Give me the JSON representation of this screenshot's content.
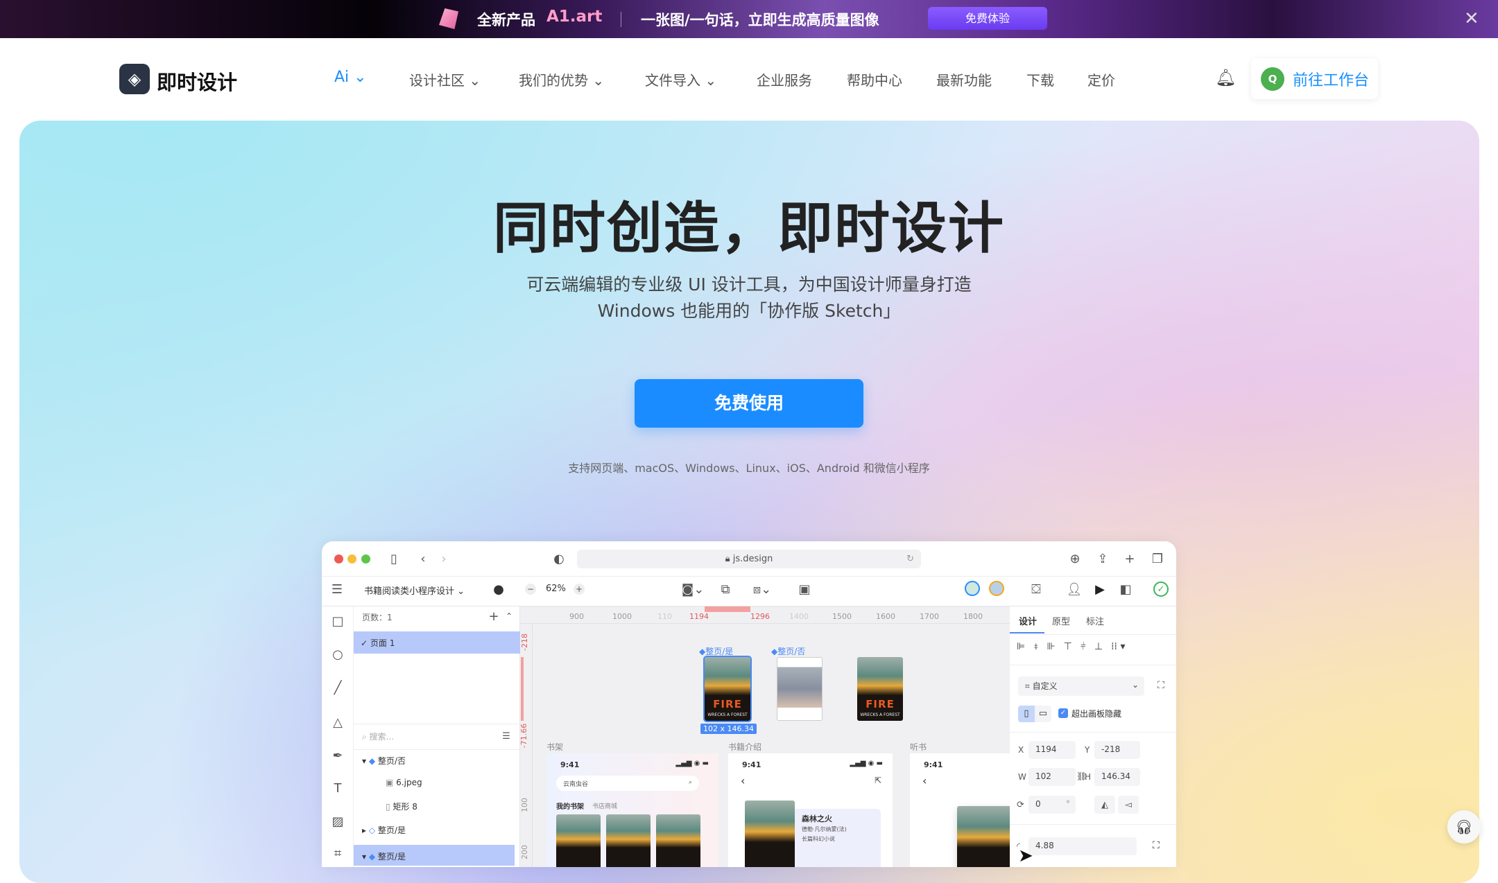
{
  "banner": {
    "product": "全新产品",
    "brand": "A1.art",
    "slogan": "一张图/一句话，立即生成高质量图像",
    "cta": "免费体验"
  },
  "nav": {
    "logo": "即时设计",
    "items": [
      {
        "label": "Ai",
        "dropdown": true
      },
      {
        "label": "设计社区",
        "dropdown": true
      },
      {
        "label": "我们的优势",
        "dropdown": true
      },
      {
        "label": "文件导入",
        "dropdown": true
      },
      {
        "label": "企业服务"
      },
      {
        "label": "帮助中心"
      },
      {
        "label": "最新功能"
      },
      {
        "label": "下载"
      },
      {
        "label": "定价"
      }
    ],
    "avatar_letter": "Q",
    "workspace": "前往工作台"
  },
  "hero": {
    "title": "同时创造，即时设计",
    "subtitle1": "可云端编辑的专业级 UI 设计工具，为中国设计师量身打造",
    "subtitle2": "Windows 也能用的「协作版 Sketch」",
    "cta": "免费使用",
    "platforms": "支持网页端、macOS、Windows、Linux、iOS、Android 和微信小程序"
  },
  "colors": {
    "accent": "#1890ff",
    "primary_button": "#1a8cff",
    "banner_button": "#7b4dff",
    "ruler_red": "#e05a5a",
    "selection": "#4a8af4"
  },
  "mock": {
    "url": "js.design",
    "file": "书籍阅读类小程序设计",
    "zoom": "62%",
    "ruler": [
      "900",
      "1000",
      "110",
      "1194",
      "1296",
      "1400",
      "1500",
      "1600",
      "1700",
      "1800"
    ],
    "vruler": [
      "-218",
      "-71.66",
      "100",
      "200"
    ],
    "pages_label": "页数：1",
    "page1": "页面 1",
    "search": "搜索...",
    "layers": [
      {
        "label": "整页/否",
        "kind": "component",
        "expanded": true
      },
      {
        "label": "6.jpeg",
        "kind": "image",
        "child": true
      },
      {
        "label": "矩形 8",
        "kind": "rect",
        "child": true
      },
      {
        "label": "整页/是",
        "kind": "instance",
        "expanded": false
      },
      {
        "label": "整页/是",
        "kind": "component",
        "expanded": true,
        "selected": true
      }
    ],
    "frames": {
      "sel_label": "整页/是",
      "size": "102 x 146.34",
      "other_label": "整页/否",
      "book_title": "FIRE",
      "book_sub": "WRECKS A FOREST"
    },
    "sections": [
      "书架",
      "书籍介绍",
      "听书"
    ],
    "phone": {
      "time": "9:41",
      "search": "云南虫谷",
      "tab1": "我的书架",
      "tab2": "书店商城",
      "book_name": "森林之火",
      "author": "德勒·凡尔纳蒙(法)",
      "genre": "长篇科幻小说"
    },
    "right": {
      "tabs": [
        "设计",
        "原型",
        "标注"
      ],
      "preset": "自定义",
      "clip": "超出画板隐藏",
      "x_label": "X",
      "x": "1194",
      "y_label": "Y",
      "y": "-218",
      "w_label": "W",
      "w": "102",
      "h_label": "H",
      "h": "146.34",
      "rotation": "0",
      "deg": "°",
      "radius": "4.88"
    }
  }
}
